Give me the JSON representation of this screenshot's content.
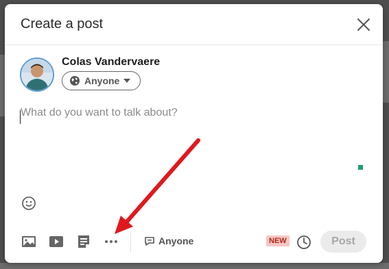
{
  "modal": {
    "title": "Create a post"
  },
  "author": {
    "name": "Colas Vandervaere",
    "visibility": "Anyone"
  },
  "composer": {
    "placeholder": "What do you want to talk about?"
  },
  "toolbar": {
    "items": [
      "image-icon",
      "video-icon",
      "document-icon",
      "more-icon"
    ],
    "comment_visibility": "Anyone",
    "new_badge": "NEW",
    "post_label": "Post"
  },
  "colors": {
    "accent_green": "#1f9e74",
    "new_badge_bg": "#f6c7c3",
    "new_badge_text": "#b1261c",
    "arrow": "#e0191e"
  }
}
